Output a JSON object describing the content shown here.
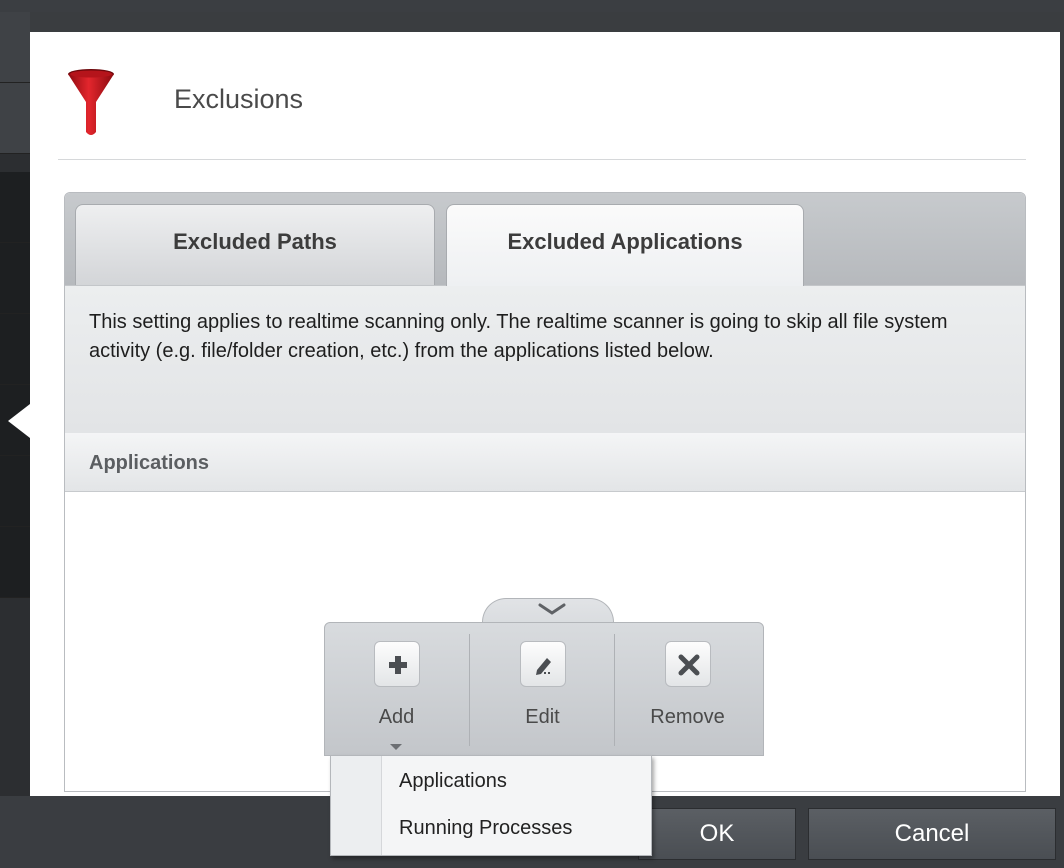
{
  "dialog": {
    "title": "Exclusions",
    "icon": "funnel-icon"
  },
  "tabs": [
    {
      "label": "Excluded Paths",
      "active": false
    },
    {
      "label": "Excluded Applications",
      "active": true
    }
  ],
  "description": "This setting applies to realtime scanning only. The realtime scanner is going to skip all file system activity (e.g. file/folder creation, etc.) from the applications listed below.",
  "list": {
    "column_header": "Applications",
    "rows": []
  },
  "toolbar": {
    "collapse_icon": "chevron-down-icon",
    "add_label": "Add",
    "edit_label": "Edit",
    "remove_label": "Remove"
  },
  "add_menu": {
    "items": [
      "Applications",
      "Running Processes"
    ]
  },
  "footer": {
    "ok_label": "OK",
    "cancel_label": "Cancel"
  },
  "colors": {
    "accent_red": "#d0121b",
    "background_dark": "#3a3d40"
  }
}
